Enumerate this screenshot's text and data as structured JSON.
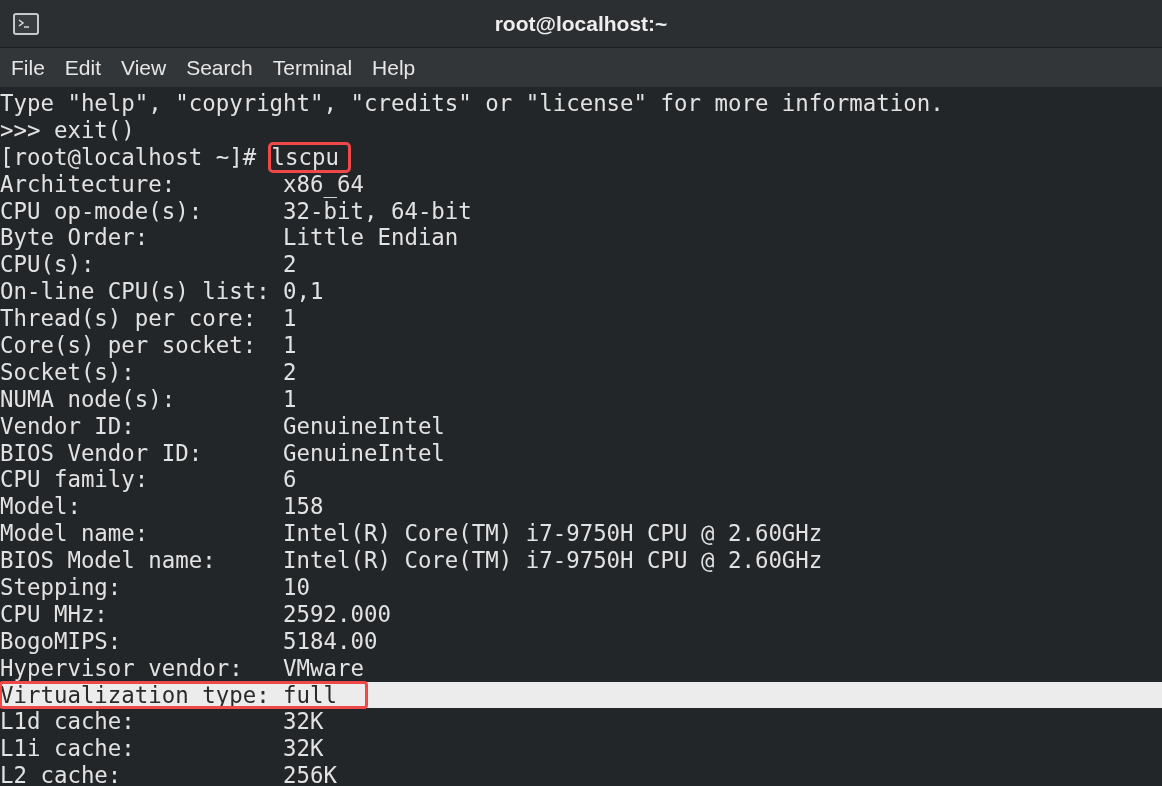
{
  "window": {
    "title": "root@localhost:~"
  },
  "menu": [
    "File",
    "Edit",
    "View",
    "Search",
    "Terminal",
    "Help"
  ],
  "lines": [
    {
      "kind": "output",
      "text": "Type \"help\", \"copyright\", \"credits\" or \"license\" for more information.",
      "highlighted": false,
      "annotated": false
    },
    {
      "kind": "output",
      "text": ">>> exit()",
      "highlighted": false,
      "annotated": false
    },
    {
      "kind": "prompt",
      "prompt": "[root@localhost ~]#",
      "command": "lscpu",
      "highlighted": false,
      "annotated": true
    },
    {
      "kind": "output",
      "text": "Architecture:        x86_64",
      "highlighted": false,
      "annotated": false
    },
    {
      "kind": "output",
      "text": "CPU op-mode(s):      32-bit, 64-bit",
      "highlighted": false,
      "annotated": false
    },
    {
      "kind": "output",
      "text": "Byte Order:          Little Endian",
      "highlighted": false,
      "annotated": false
    },
    {
      "kind": "output",
      "text": "CPU(s):              2",
      "highlighted": false,
      "annotated": false
    },
    {
      "kind": "output",
      "text": "On-line CPU(s) list: 0,1",
      "highlighted": false,
      "annotated": false
    },
    {
      "kind": "output",
      "text": "Thread(s) per core:  1",
      "highlighted": false,
      "annotated": false
    },
    {
      "kind": "output",
      "text": "Core(s) per socket:  1",
      "highlighted": false,
      "annotated": false
    },
    {
      "kind": "output",
      "text": "Socket(s):           2",
      "highlighted": false,
      "annotated": false
    },
    {
      "kind": "output",
      "text": "NUMA node(s):        1",
      "highlighted": false,
      "annotated": false
    },
    {
      "kind": "output",
      "text": "Vendor ID:           GenuineIntel",
      "highlighted": false,
      "annotated": false
    },
    {
      "kind": "output",
      "text": "BIOS Vendor ID:      GenuineIntel",
      "highlighted": false,
      "annotated": false
    },
    {
      "kind": "output",
      "text": "CPU family:          6",
      "highlighted": false,
      "annotated": false
    },
    {
      "kind": "output",
      "text": "Model:               158",
      "highlighted": false,
      "annotated": false
    },
    {
      "kind": "output",
      "text": "Model name:          Intel(R) Core(TM) i7-9750H CPU @ 2.60GHz",
      "highlighted": false,
      "annotated": false
    },
    {
      "kind": "output",
      "text": "BIOS Model name:     Intel(R) Core(TM) i7-9750H CPU @ 2.60GHz",
      "highlighted": false,
      "annotated": false
    },
    {
      "kind": "output",
      "text": "Stepping:            10",
      "highlighted": false,
      "annotated": false
    },
    {
      "kind": "output",
      "text": "CPU MHz:             2592.000",
      "highlighted": false,
      "annotated": false
    },
    {
      "kind": "output",
      "text": "BogoMIPS:            5184.00",
      "highlighted": false,
      "annotated": false
    },
    {
      "kind": "output",
      "text": "Hypervisor vendor:   VMware",
      "highlighted": false,
      "annotated": false
    },
    {
      "kind": "output",
      "text": "Virtualization type: full",
      "highlighted": true,
      "annotated": true
    },
    {
      "kind": "output",
      "text": "L1d cache:           32K",
      "highlighted": false,
      "annotated": false
    },
    {
      "kind": "output",
      "text": "L1i cache:           32K",
      "highlighted": false,
      "annotated": false
    },
    {
      "kind": "output",
      "text": "L2 cache:            256K",
      "highlighted": false,
      "annotated": false
    }
  ]
}
